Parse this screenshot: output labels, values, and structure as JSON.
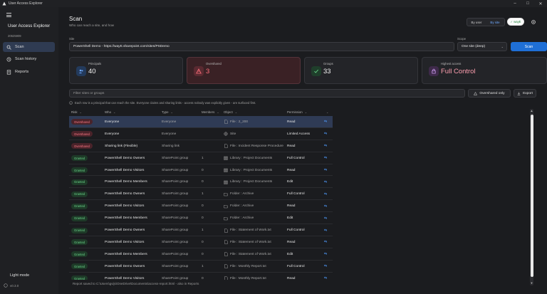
{
  "window": {
    "title": "User Access Explorer"
  },
  "sidebar": {
    "app_name": "User Access Explorer",
    "date": "20625909",
    "items": [
      {
        "label": "Scan",
        "icon": "search-icon",
        "active": true
      },
      {
        "label": "Scan history",
        "icon": "history-icon",
        "active": false
      },
      {
        "label": "Reports",
        "icon": "report-icon",
        "active": false
      }
    ],
    "light_mode": "Light mode",
    "version": "v0.3.0"
  },
  "header": {
    "title": "Scan",
    "subtitle": "Who can reach a site, and how",
    "view_toggle": {
      "by_user": "By user",
      "by_site": "By site"
    },
    "status_pill": "wayE"
  },
  "form": {
    "site_label": "Site",
    "site_value": "PowerShell Demo - https://wayE.sharepoint.com/sites/PSDemo",
    "scope_label": "Scope",
    "scope_value": "One site (deep)",
    "scan_button": "Scan"
  },
  "cards": [
    {
      "label": "Principals",
      "value": "40",
      "icon": "users-icon"
    },
    {
      "label": "Overshared",
      "value": "3",
      "icon": "warning-icon"
    },
    {
      "label": "Groups",
      "value": "33",
      "icon": "check-icon"
    },
    {
      "label": "Highest access",
      "value": "Full Control",
      "icon": "lock-icon"
    }
  ],
  "filter": {
    "placeholder": "Filter sites or groups",
    "overshared_only": "Overshared only",
    "export": "Export"
  },
  "hint": "Each row is a principal that can reach the site. Everyone claims and sharing links - access nobody was explicitly given - are surfaced first.",
  "table": {
    "columns": [
      "Risk",
      "Who",
      "Type",
      "Members",
      "Object",
      "Permission",
      ""
    ],
    "rows": [
      {
        "risk": "Overshared",
        "who": "Everyone",
        "type": "Everyone",
        "members": "",
        "object": "File : 2_200",
        "object_icon": "file-icon",
        "permission": "Read"
      },
      {
        "risk": "Overshared",
        "who": "Everyone",
        "type": "Everyone",
        "members": "",
        "object": "Site",
        "object_icon": "globe-icon",
        "permission": "Limited Access"
      },
      {
        "risk": "Overshared",
        "who": "Sharing link (Flexible)",
        "type": "Sharing link",
        "members": "",
        "object": "File : Incident Response Procedure",
        "object_icon": "file-icon",
        "permission": "Read"
      },
      {
        "risk": "Granted",
        "who": "PowerShell Demo Owners",
        "type": "SharePoint group",
        "members": "1",
        "object": "Library : Project Documents",
        "object_icon": "library-icon",
        "permission": "Full Control"
      },
      {
        "risk": "Granted",
        "who": "PowerShell Demo Visitors",
        "type": "SharePoint group",
        "members": "0",
        "object": "Library : Project Documents",
        "object_icon": "library-icon",
        "permission": "Read"
      },
      {
        "risk": "Granted",
        "who": "PowerShell Demo Members",
        "type": "SharePoint group",
        "members": "0",
        "object": "Library : Project Documents",
        "object_icon": "library-icon",
        "permission": "Edit"
      },
      {
        "risk": "Granted",
        "who": "PowerShell Demo Owners",
        "type": "SharePoint group",
        "members": "1",
        "object": "Folder : Archive",
        "object_icon": "folder-icon",
        "permission": "Full Control"
      },
      {
        "risk": "Granted",
        "who": "PowerShell Demo Visitors",
        "type": "SharePoint group",
        "members": "0",
        "object": "Folder : Archive",
        "object_icon": "folder-icon",
        "permission": "Read"
      },
      {
        "risk": "Granted",
        "who": "PowerShell Demo Members",
        "type": "SharePoint group",
        "members": "0",
        "object": "Folder : Archive",
        "object_icon": "folder-icon",
        "permission": "Edit"
      },
      {
        "risk": "Granted",
        "who": "PowerShell Demo Owners",
        "type": "SharePoint group",
        "members": "1",
        "object": "File : Statement of Work.txt",
        "object_icon": "file-icon",
        "permission": "Full Control"
      },
      {
        "risk": "Granted",
        "who": "PowerShell Demo Visitors",
        "type": "SharePoint group",
        "members": "0",
        "object": "File : Statement of Work.txt",
        "object_icon": "file-icon",
        "permission": "Read"
      },
      {
        "risk": "Granted",
        "who": "PowerShell Demo Members",
        "type": "SharePoint group",
        "members": "0",
        "object": "File : Statement of Work.txt",
        "object_icon": "file-icon",
        "permission": "Edit"
      },
      {
        "risk": "Granted",
        "who": "PowerShell Demo Owners",
        "type": "SharePoint group",
        "members": "1",
        "object": "File : Monthly Report.txt",
        "object_icon": "file-icon",
        "permission": "Full Control"
      },
      {
        "risk": "Granted",
        "who": "PowerShell Demo Visitors",
        "type": "SharePoint group",
        "members": "0",
        "object": "File : Monthly Report.txt",
        "object_icon": "file-icon",
        "permission": "Read"
      }
    ]
  },
  "status_bar": "Report saved to C:\\Users\\gvijs\\OneDrive\\Documents\\access-report.html - also in Reports",
  "colors": {
    "accent": "#1f6fd6",
    "overshared": "#ff7a86",
    "granted": "#6bd68a"
  }
}
